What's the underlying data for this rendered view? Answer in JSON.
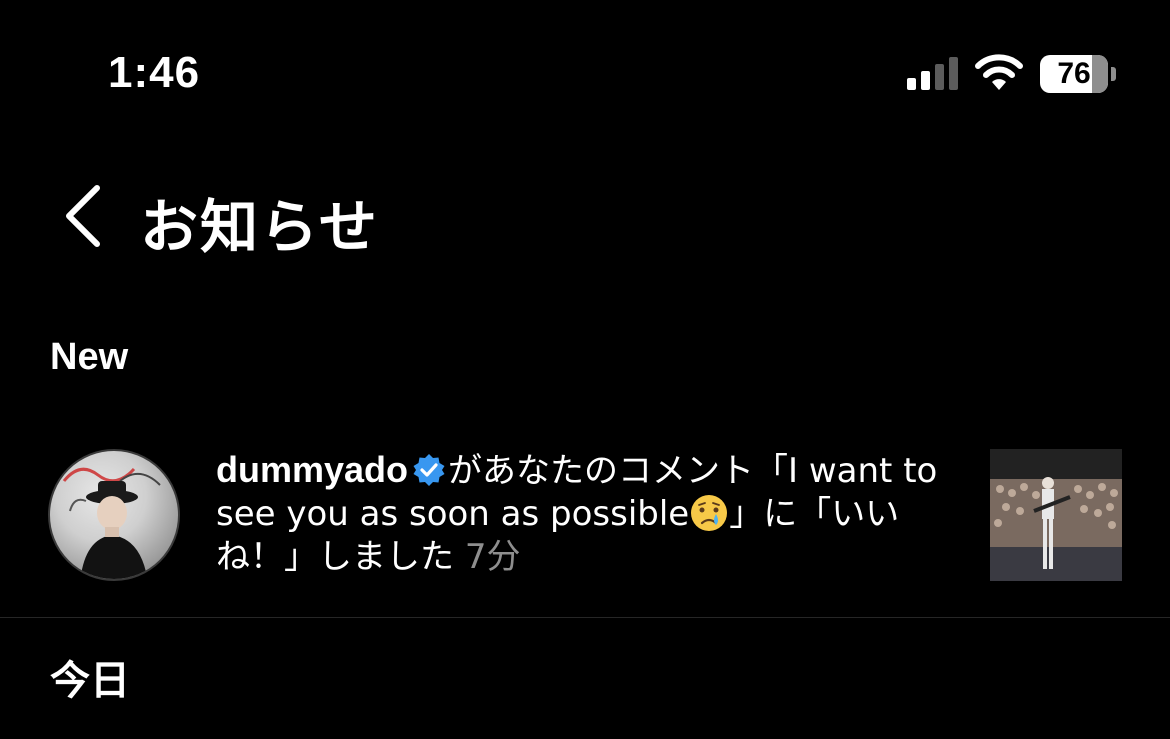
{
  "status_bar": {
    "time": "1:46",
    "battery": "76",
    "icons": [
      "cellular-signal-icon",
      "wifi-icon",
      "battery-icon"
    ]
  },
  "header": {
    "back_icon": "chevron-left-icon",
    "title": "お知らせ"
  },
  "sections": {
    "new_label": "New",
    "today_label": "今日"
  },
  "notification": {
    "username": "dummyado",
    "verified_icon": "verified-badge-icon",
    "message_part1": "があなたのコメント「I want to see you as soon as possible",
    "emoji": "crying-face-emoji",
    "message_part2": "」に「いいね！」しました",
    "time_ago": "7分"
  },
  "colors": {
    "background": "#000000",
    "text": "#ffffff",
    "muted": "#8e8e8e",
    "verified": "#3897f0",
    "divider": "#262626"
  }
}
